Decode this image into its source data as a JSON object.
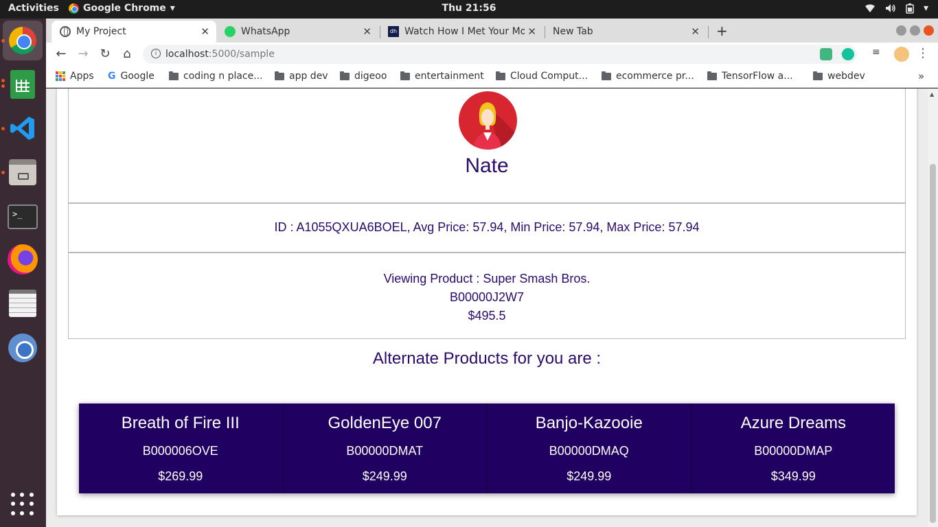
{
  "topbar": {
    "activities": "Activities",
    "app_name": "Google Chrome",
    "clock": "Thu 21:56"
  },
  "tabs": [
    {
      "title": "My Project",
      "active": true
    },
    {
      "title": "WhatsApp",
      "active": false
    },
    {
      "title": "Watch How I Met Your Mo",
      "active": false
    },
    {
      "title": "New Tab",
      "active": false
    }
  ],
  "address_bar": {
    "host": "localhost",
    "path": ":5000/sample"
  },
  "bookmarks": [
    {
      "label": "Apps",
      "icon": "apps-icon"
    },
    {
      "label": "Google",
      "icon": "google-icon"
    },
    {
      "label": "coding n place...",
      "icon": "folder-icon"
    },
    {
      "label": "app dev",
      "icon": "folder-icon"
    },
    {
      "label": "digeoo",
      "icon": "folder-icon"
    },
    {
      "label": "entertainment",
      "icon": "folder-icon"
    },
    {
      "label": "Cloud Comput...",
      "icon": "folder-icon"
    },
    {
      "label": "ecommerce pr...",
      "icon": "folder-icon"
    },
    {
      "label": "TensorFlow a...",
      "icon": "folder-icon"
    },
    {
      "label": "webdev",
      "icon": "folder-icon"
    }
  ],
  "profile": {
    "name": "Nate"
  },
  "stats_text": "ID : A1055QXUA6BOEL, Avg Price: 57.94, Min Price: 57.94, Max Price: 57.94",
  "viewing": {
    "line1": "Viewing Product : Super Smash Bros.",
    "asin": "B00000J2W7",
    "price": "$495.5"
  },
  "alternate_heading": "Alternate Products for you are :",
  "alternates": [
    {
      "name": "Breath of Fire III",
      "asin": "B000006OVE",
      "price": "$269.99"
    },
    {
      "name": "GoldenEye 007",
      "asin": "B00000DMAT",
      "price": "$249.99"
    },
    {
      "name": "Banjo-Kazooie",
      "asin": "B00000DMAQ",
      "price": "$249.99"
    },
    {
      "name": "Azure Dreams",
      "asin": "B00000DMAP",
      "price": "$349.99"
    }
  ],
  "colors": {
    "accent": "#2a0a6a",
    "card_bg": "#200060",
    "avatar_bg": "#d7262f"
  }
}
